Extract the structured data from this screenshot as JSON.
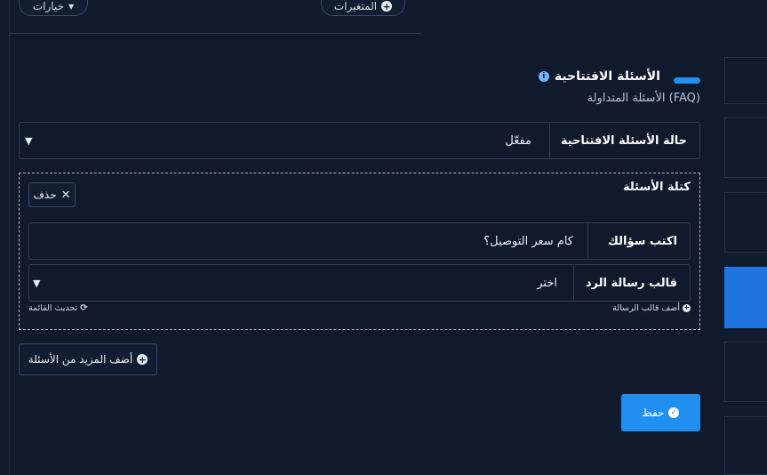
{
  "toolbar": {
    "options_label": "خيارات",
    "variables_label": "المتغيرات"
  },
  "section": {
    "title": "الأسئلة الافتتاحية",
    "subtitle": "الأسئلة المتداولة (FAQ)",
    "info_icon": "info-icon"
  },
  "status_field": {
    "label": "حالة الأسئلة الافتتاحية",
    "value": "مفعّل"
  },
  "block": {
    "title": "كتلة الأسئلة",
    "delete_label": "حذف",
    "question": {
      "label": "اكتب سؤالك",
      "value": "كام سعر التوصيل؟"
    },
    "template": {
      "label": "قالب رسالة الرد",
      "value": "اختر"
    },
    "add_template_link": "أضف قالب الرسالة",
    "refresh_link": "تحديث القائمة"
  },
  "add_more_label": "أضف المزيد من الأسئلة",
  "save_label": "حفظ",
  "colors": {
    "accent": "#1f8ff0",
    "background": "#0f1a2c",
    "border": "#2e3d54"
  }
}
